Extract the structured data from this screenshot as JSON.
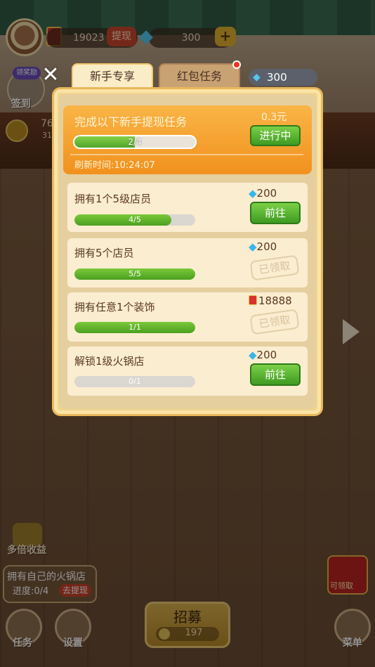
{
  "hud": {
    "red_packet_balance": "19023",
    "withdraw_label": "提现",
    "gem_count": "300",
    "plus_label": "+",
    "signin_tag": "领奖励",
    "signin_label": "签到",
    "coin_value": "76",
    "coin_sub": "31"
  },
  "dialog": {
    "tabs": [
      {
        "label": "新手专享",
        "active": true
      },
      {
        "label": "红包任务",
        "active": false,
        "has_dot": true
      }
    ],
    "gem_balance": "300",
    "close_label": "✕",
    "hero": {
      "title": "完成以下新手提现任务",
      "amount": "0.3元",
      "progress_text": "2/4",
      "progress": 0.5,
      "refresh_text": "刷新时间:10:24:07",
      "status_label": "进行中"
    },
    "tasks": [
      {
        "title": "拥有1个5级店员",
        "reward": "200",
        "reward_type": "gem",
        "progress_text": "4/5",
        "progress": 0.8,
        "action": "前往",
        "claimed": false
      },
      {
        "title": "拥有5个店员",
        "reward": "200",
        "reward_type": "gem",
        "progress_text": "5/5",
        "progress": 1.0,
        "action": "已领取",
        "claimed": true
      },
      {
        "title": "拥有任意1个装饰",
        "reward": "18888",
        "reward_type": "red_packet",
        "progress_text": "1/1",
        "progress": 1.0,
        "action": "已领取",
        "claimed": true
      },
      {
        "title": "解锁1级火锅店",
        "reward": "200",
        "reward_type": "gem",
        "progress_text": "0/1",
        "progress": 0.0,
        "action": "前往",
        "claimed": false
      }
    ]
  },
  "bottom": {
    "multiplier_label": "多倍收益",
    "goal_title": "拥有自己的火锅店",
    "goal_progress": "进度:0/4",
    "goal_button": "去提现",
    "task_label": "任务",
    "settings_label": "设置",
    "recruit_label": "招募",
    "recruit_cost": "197",
    "red_envelope_label": "可领取",
    "menu_label": "菜单"
  },
  "colors": {
    "accent_orange": "#f1911e",
    "go_green": "#3f9a23",
    "gem_blue": "#38b6ec",
    "panel_gold": "#f3d48a"
  }
}
